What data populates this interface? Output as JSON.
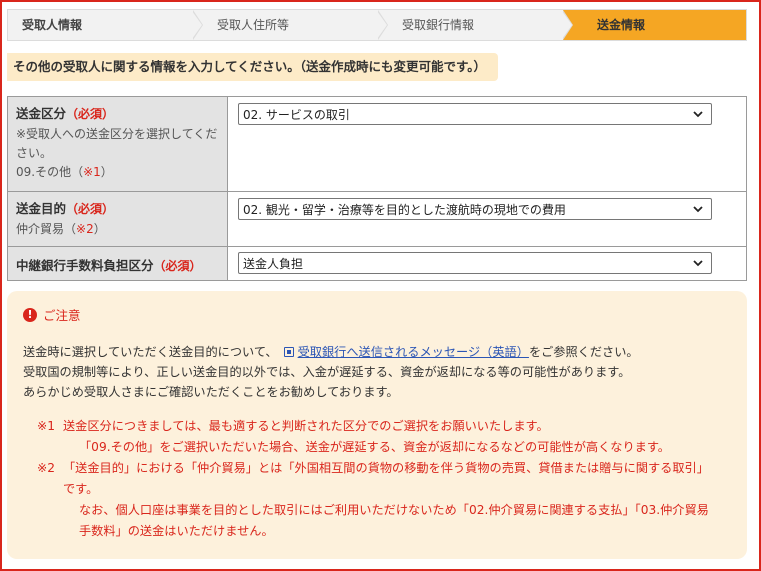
{
  "steps": [
    {
      "label": "受取人情報"
    },
    {
      "label": "受取人住所等"
    },
    {
      "label": "受取銀行情報"
    },
    {
      "label": "送金情報"
    }
  ],
  "intro": "その他の受取人に関する情報を入力してください。（送金作成時にも変更可能です。）",
  "form": {
    "purpose_class": {
      "label": "送金区分",
      "required": "（必須）",
      "note1": "※受取人への送金区分を選択してください。",
      "note2_prefix": "09.その他（",
      "note2_mark": "※1",
      "note2_suffix": "）",
      "value": "02. サービスの取引"
    },
    "purpose": {
      "label": "送金目的",
      "required": "（必須）",
      "note_prefix": "仲介貿易（",
      "note_mark": "※2",
      "note_suffix": "）",
      "value": "02. 観光・留学・治療等を目的とした渡航時の現地での費用"
    },
    "fee": {
      "label": "中継銀行手数料負担区分",
      "required": "（必須）",
      "value": "送金人負担"
    }
  },
  "notice": {
    "title": "ご注意",
    "line1_prefix": "送金時に選択していただく送金目的について、",
    "line1_link": "受取銀行へ送信されるメッセージ（英語）",
    "line1_suffix": "をご参照ください。",
    "line2": "受取国の規制等により、正しい送金目的以外では、入金が遅延する、資金が返却になる等の可能性があります。",
    "line3": "あらかじめ受取人さまにご確認いただくことをお勧めしております。",
    "n1_mark": "※1",
    "n1_text": "送金区分につきましては、最も適すると判断された区分でのご選択をお願いいたします。",
    "n1_text2": "「09.その他」をご選択いただいた場合、送金が遅延する、資金が返却になるなどの可能性が高くなります。",
    "n2_mark": "※2",
    "n2_text": "「送金目的」における「仲介貿易」とは「外国相互間の貨物の移動を伴う貨物の売買、貸借または贈与に関する取引」です。",
    "n2_text2": "なお、個人口座は事業を目的とした取引にはご利用いただけないため「02.仲介貿易に関連する支払」「03.仲介貿易手数料」の送金はいただけません。"
  },
  "colors": {
    "accent": "#f5a623",
    "required": "#d9261c",
    "link": "#2b55b5",
    "notice_bg": "#fdf1dc"
  }
}
